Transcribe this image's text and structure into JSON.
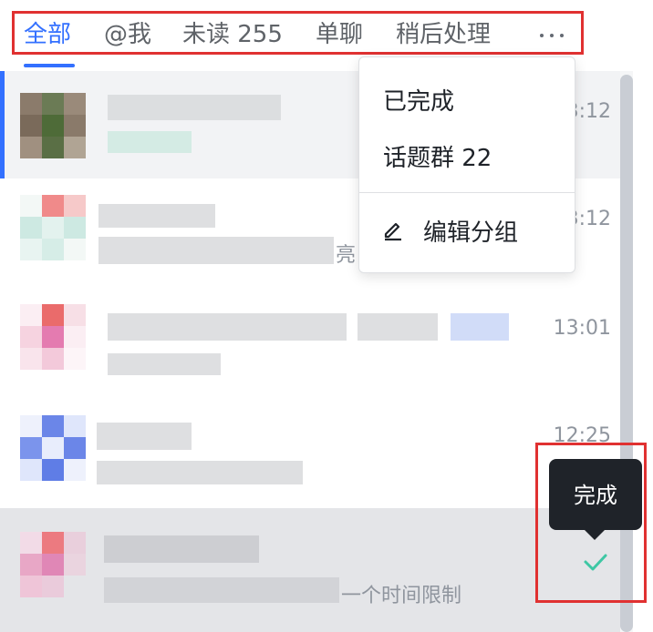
{
  "tabs": [
    {
      "label": "全部",
      "active": true
    },
    {
      "label": "@我",
      "active": false
    },
    {
      "label": "未读 255",
      "active": false
    },
    {
      "label": "单聊",
      "active": false
    },
    {
      "label": "稍后处理",
      "active": false
    }
  ],
  "more_icon": "more-horizontal-icon",
  "dropdown": {
    "items": [
      {
        "label": "已完成"
      },
      {
        "label": "话题群 22"
      }
    ],
    "edit_item": {
      "label": "编辑分组",
      "icon": "pencil-icon"
    }
  },
  "conversations": [
    {
      "time": "13:12",
      "preview_suffix": ""
    },
    {
      "time": "13:12",
      "preview_suffix": "亮"
    },
    {
      "time": "13:01",
      "preview_suffix": ""
    },
    {
      "time": "12:25",
      "preview_suffix": ""
    },
    {
      "time": "",
      "preview_suffix": "一个时间限制"
    }
  ],
  "tooltip": {
    "label": "完成"
  },
  "done_action": {
    "icon": "check-icon"
  },
  "colors": {
    "accent": "#3370ff",
    "highlight": "#e03131",
    "check": "#3ec7a4",
    "tooltip_bg": "#1f2329"
  }
}
